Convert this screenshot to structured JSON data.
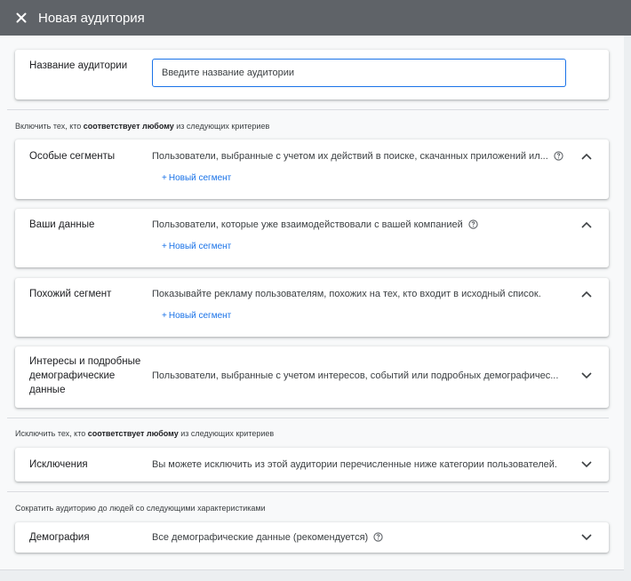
{
  "header": {
    "title": "Новая аудитория",
    "close_icon": "close-icon"
  },
  "audience_name": {
    "label": "Название аудитории",
    "placeholder": "Введите название аудитории",
    "value": ""
  },
  "include_section": {
    "prefix": "Включить тех, кто",
    "emphasis": "соответствует любому",
    "suffix": "из следующих критериев"
  },
  "custom_segments": {
    "label": "Особые сегменты",
    "description": "Пользователи, выбранные с учетом их действий в поиске, скачанных приложений ил...",
    "add_label": "Новый сегмент",
    "expanded": true
  },
  "your_data": {
    "label": "Ваши данные",
    "description": "Пользователи, которые уже взаимодействовали с вашей компанией",
    "add_label": "Новый сегмент",
    "expanded": true
  },
  "similar_segment": {
    "label": "Похожий сегмент",
    "description": "Показывайте рекламу пользователям, похожих на тех, кто входит в исходный список.",
    "add_label": "Новый сегмент",
    "expanded": true
  },
  "interests": {
    "label_line1": "Интересы и подробные",
    "label_line2": "демографические",
    "label_line3": "данные",
    "description": "Пользователи, выбранные с учетом интересов, событий или подробных демографичес...",
    "expanded": false
  },
  "exclude_section": {
    "prefix": "Исключить тех, кто",
    "emphasis": "соответствует любому",
    "suffix": "из следующих критериев"
  },
  "exclusions": {
    "label": "Исключения",
    "description": "Вы можете исключить из этой аудитории перечисленные ниже категории пользователей.",
    "expanded": false
  },
  "narrow_section": {
    "text": "Сократить аудиторию до людей со следующими характеристиками"
  },
  "demographics": {
    "label": "Демография",
    "description": "Все демографические данные (рекомендуется)",
    "expanded": false
  },
  "colors": {
    "header_bg": "#5f6368",
    "accent": "#1a73e8",
    "page_bg": "#f8f9fa"
  }
}
